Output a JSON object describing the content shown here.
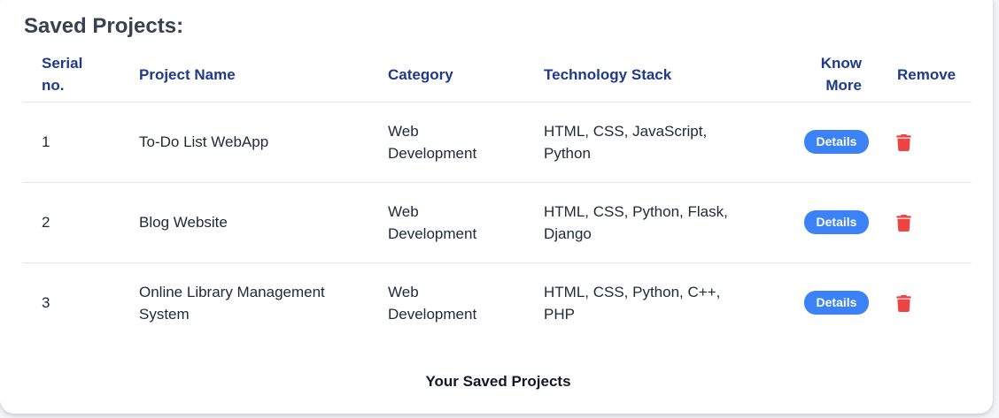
{
  "heading": "Saved Projects:",
  "columns": {
    "serial": "Serial no.",
    "name": "Project Name",
    "category": "Category",
    "tech": "Technology Stack",
    "know": "Know More",
    "remove": "Remove"
  },
  "rows": [
    {
      "serial": "1",
      "name": "To-Do List WebApp",
      "category": "Web Development",
      "tech": "HTML, CSS, JavaScript, Python",
      "details": "Details"
    },
    {
      "serial": "2",
      "name": "Blog Website",
      "category": "Web Development",
      "tech": "HTML, CSS, Python, Flask, Django",
      "details": "Details"
    },
    {
      "serial": "3",
      "name": "Online Library Management System",
      "category": "Web Development",
      "tech": "HTML, CSS, Python, C++, PHP",
      "details": "Details"
    }
  ],
  "caption": "Your Saved Projects",
  "colors": {
    "accent": "#3b82f6",
    "header_text": "#1e3a8a",
    "delete": "#ef4444"
  }
}
